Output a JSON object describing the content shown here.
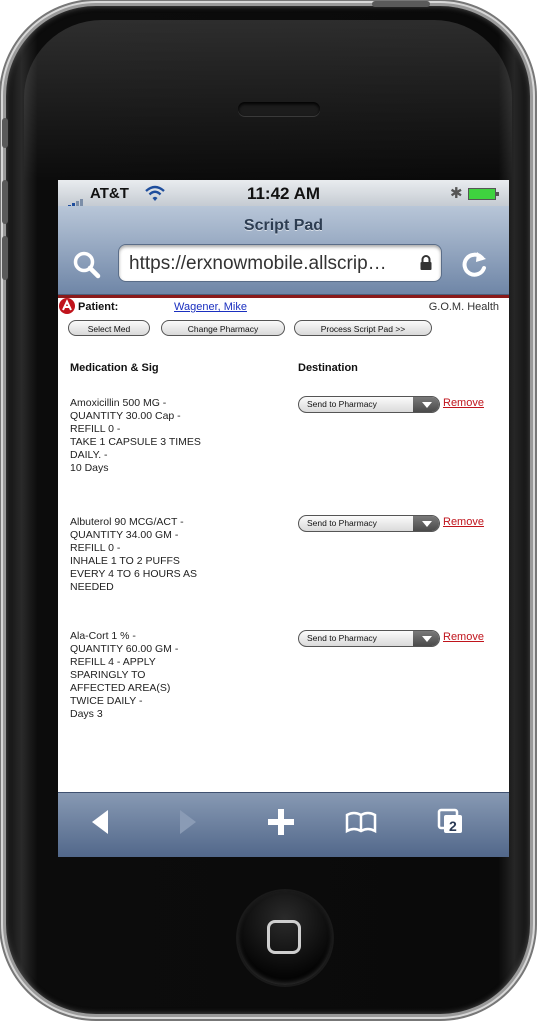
{
  "status_bar": {
    "carrier": "AT&T",
    "time": "11:42 AM"
  },
  "browser": {
    "page_title": "Script Pad",
    "url": "https://erxnowmobile.allscrip…",
    "tabs_count": "2"
  },
  "page": {
    "patient_label": "Patient:",
    "patient_name": "Wagener, Mike",
    "organization": "G.O.M. Health",
    "buttons": {
      "select_med": "Select Med",
      "change_pharmacy": "Change Pharmacy",
      "process_script_pad": "Process Script Pad >>"
    },
    "columns": {
      "medication": "Medication & Sig",
      "destination": "Destination"
    },
    "medications": [
      {
        "lines": [
          "Amoxicillin 500 MG -",
          "QUANTITY 30.00 Cap -",
          "REFILL 0 -",
          "TAKE 1 CAPSULE 3 TIMES",
          "DAILY. -",
          "10 Days"
        ],
        "destination": "Send to Pharmacy",
        "remove": "Remove"
      },
      {
        "lines": [
          "Albuterol 90 MCG/ACT -",
          "QUANTITY 34.00 GM -",
          "REFILL 0 -",
          "INHALE  1 TO 2 PUFFS",
          " EVERY 4 TO 6 HOURS AS",
          "NEEDED"
        ],
        "destination": "Send to Pharmacy",
        "remove": "Remove"
      },
      {
        "lines": [
          "Ala-Cort 1 % -",
          "QUANTITY 60.00 GM -",
          "REFILL 4 - APPLY",
          "SPARINGLY TO",
          "AFFECTED AREA(S)",
          "TWICE DAILY -",
          "Days 3"
        ],
        "destination": "Send to Pharmacy",
        "remove": "Remove"
      }
    ]
  },
  "colors": {
    "accent_red": "#c0141c",
    "link_blue": "#1a2fbf",
    "toolbar_blue": "#51678a"
  },
  "icons": [
    "wifi-icon",
    "bluetooth-icon",
    "battery-icon",
    "search-icon",
    "lock-icon",
    "reload-icon",
    "back-icon",
    "forward-icon",
    "add-icon",
    "bookmarks-icon",
    "pages-icon",
    "home-square-icon",
    "allscripts-logo-icon"
  ]
}
